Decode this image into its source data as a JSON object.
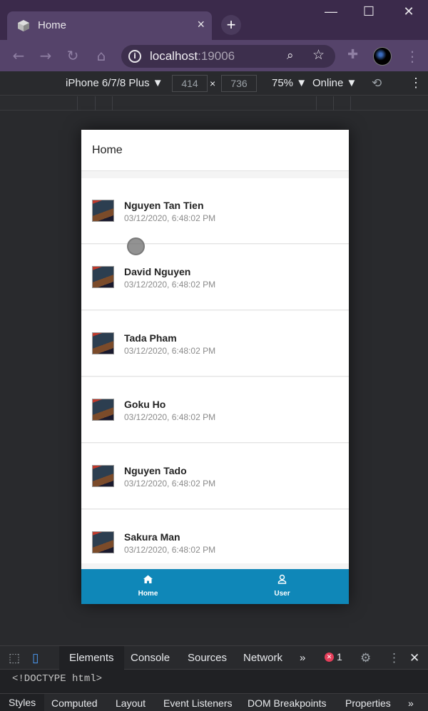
{
  "browser": {
    "tab_title": "Home",
    "tab_close": "×",
    "new_tab": "+",
    "win_min": "—",
    "win_max": "☐",
    "win_close": "✕",
    "url_host": "localhost",
    "url_port": ":19006"
  },
  "device_toolbar": {
    "device": "iPhone 6/7/8 Plus ▼",
    "width": "414",
    "height": "736",
    "times": "×",
    "zoom": "75% ▼",
    "network": "Online ▼"
  },
  "app": {
    "header_title": "Home",
    "items": [
      {
        "name": "Nguyen Tan Tien",
        "time": "03/12/2020, 6:48:02 PM"
      },
      {
        "name": "David Nguyen",
        "time": "03/12/2020, 6:48:02 PM"
      },
      {
        "name": "Tada Pham",
        "time": "03/12/2020, 6:48:02 PM"
      },
      {
        "name": "Goku Ho",
        "time": "03/12/2020, 6:48:02 PM"
      },
      {
        "name": "Nguyen Tado",
        "time": "03/12/2020, 6:48:02 PM"
      },
      {
        "name": "Sakura Man",
        "time": "03/12/2020, 6:48:02 PM"
      }
    ],
    "tabs": [
      {
        "label": "Home",
        "icon": "home-icon"
      },
      {
        "label": "User",
        "icon": "user-icon"
      }
    ],
    "tabbar_color": "#0f87b8"
  },
  "devtools": {
    "tabs": [
      "Elements",
      "Console",
      "Sources",
      "Network"
    ],
    "more": "»",
    "error_count": "1",
    "dom_line": "<!DOCTYPE html>",
    "subtabs": [
      "Styles",
      "Computed",
      "Layout",
      "Event Listeners",
      "DOM Breakpoints",
      "Properties"
    ],
    "subtabs_more": "»"
  }
}
